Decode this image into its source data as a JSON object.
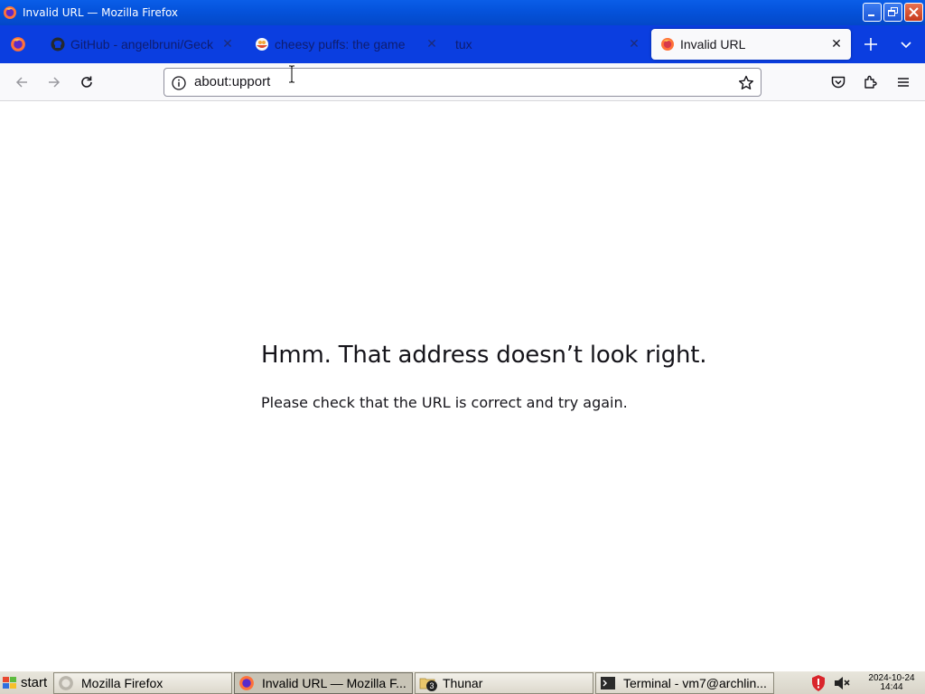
{
  "window": {
    "title": "Invalid URL — Mozilla Firefox",
    "buttons": [
      "minimize",
      "restore",
      "close"
    ]
  },
  "tabs": [
    {
      "label": "GitHub - angelbruni/Geck",
      "icon": "github-icon",
      "active": false
    },
    {
      "label": "cheesy puffs: the game",
      "icon": "cheese-icon",
      "active": false
    },
    {
      "label": "tux",
      "icon": "",
      "active": false
    },
    {
      "label": "Invalid URL",
      "icon": "firefox-icon",
      "active": true
    }
  ],
  "navbar": {
    "url": "about:upport"
  },
  "page": {
    "title": "Hmm. That address doesn’t look right.",
    "description": "Please check that the URL is correct and try again."
  },
  "taskbar": {
    "start_label": "start",
    "tasks": [
      {
        "label": "Mozilla Firefox",
        "icon": "firefox-icon",
        "active": false
      },
      {
        "label": "Invalid URL — Mozilla F...",
        "icon": "firefox-icon",
        "active": true
      },
      {
        "label": "Thunar",
        "icon": "folder-icon",
        "badge": "3",
        "active": false
      },
      {
        "label": "Terminal - vm7@archlin...",
        "icon": "terminal-icon",
        "active": false
      }
    ],
    "clock_date": "2024-10-24",
    "clock_time": "14:44"
  },
  "colors": {
    "titlebar": "#0553dc",
    "tabstrip": "#0b3ee0",
    "taskbar": "#d8d4c8"
  }
}
